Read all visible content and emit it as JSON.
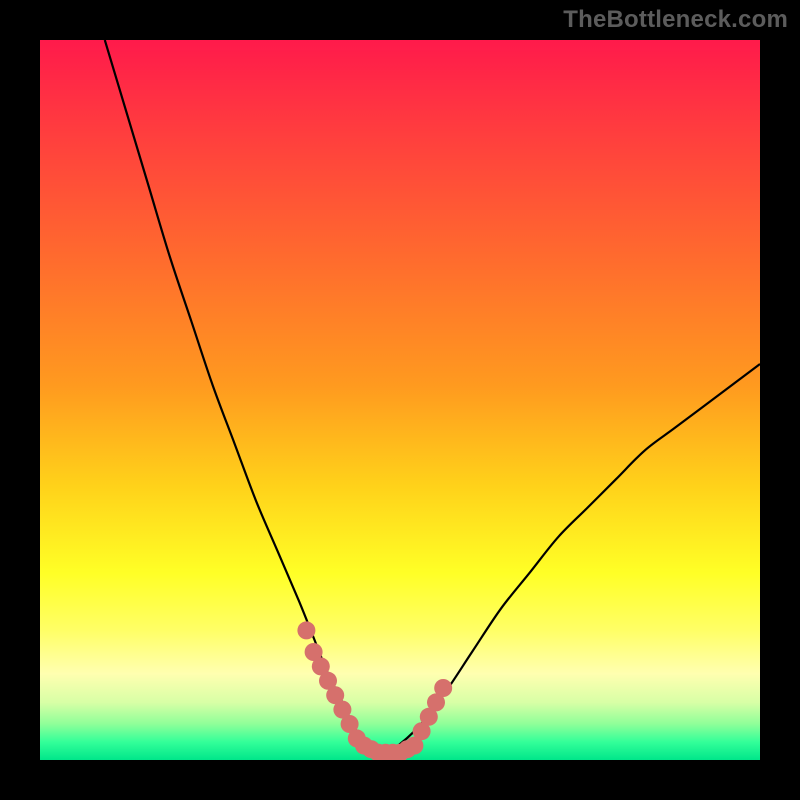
{
  "watermark": "TheBottleneck.com",
  "chart_data": {
    "type": "line",
    "title": "",
    "xlabel": "",
    "ylabel": "",
    "xlim": [
      0,
      100
    ],
    "ylim": [
      0,
      100
    ],
    "grid": false,
    "legend": false,
    "series": [
      {
        "name": "bottleneck-curve",
        "color": "#000000",
        "x": [
          9,
          12,
          15,
          18,
          21,
          24,
          27,
          30,
          33,
          36,
          38,
          40,
          42,
          44,
          46,
          48,
          52,
          56,
          60,
          64,
          68,
          72,
          76,
          80,
          84,
          88,
          92,
          96,
          100
        ],
        "y": [
          100,
          90,
          80,
          70,
          61,
          52,
          44,
          36,
          29,
          22,
          17,
          12,
          8,
          4,
          2,
          1,
          4,
          9,
          15,
          21,
          26,
          31,
          35,
          39,
          43,
          46,
          49,
          52,
          55
        ]
      }
    ],
    "annotations": [
      {
        "name": "highlight-left-descent",
        "type": "dots",
        "color": "#d6706c",
        "points": [
          [
            37,
            18
          ],
          [
            38,
            15
          ],
          [
            39,
            13
          ],
          [
            40,
            11
          ],
          [
            41,
            9
          ],
          [
            42,
            7
          ],
          [
            43,
            5
          ]
        ]
      },
      {
        "name": "highlight-trough",
        "type": "dots",
        "color": "#d6706c",
        "points": [
          [
            44,
            3
          ],
          [
            45,
            2
          ],
          [
            46,
            1.5
          ],
          [
            47,
            1
          ],
          [
            48,
            1
          ],
          [
            49,
            1
          ],
          [
            50,
            1
          ],
          [
            51,
            1.5
          ],
          [
            52,
            2
          ]
        ]
      },
      {
        "name": "highlight-right-ascent",
        "type": "dots",
        "color": "#d6706c",
        "points": [
          [
            53,
            4
          ],
          [
            54,
            6
          ],
          [
            55,
            8
          ],
          [
            56,
            10
          ]
        ]
      }
    ],
    "background_gradient": {
      "type": "vertical",
      "stops": [
        {
          "offset": 0.0,
          "color": "#ff1a4b"
        },
        {
          "offset": 0.12,
          "color": "#ff3b3f"
        },
        {
          "offset": 0.3,
          "color": "#ff6a2e"
        },
        {
          "offset": 0.48,
          "color": "#ff9a1f"
        },
        {
          "offset": 0.62,
          "color": "#ffd21a"
        },
        {
          "offset": 0.74,
          "color": "#ffff26"
        },
        {
          "offset": 0.82,
          "color": "#ffff66"
        },
        {
          "offset": 0.88,
          "color": "#ffffb0"
        },
        {
          "offset": 0.92,
          "color": "#d8ffa6"
        },
        {
          "offset": 0.95,
          "color": "#8fff99"
        },
        {
          "offset": 0.975,
          "color": "#33ff99"
        },
        {
          "offset": 1.0,
          "color": "#00e68a"
        }
      ]
    }
  }
}
